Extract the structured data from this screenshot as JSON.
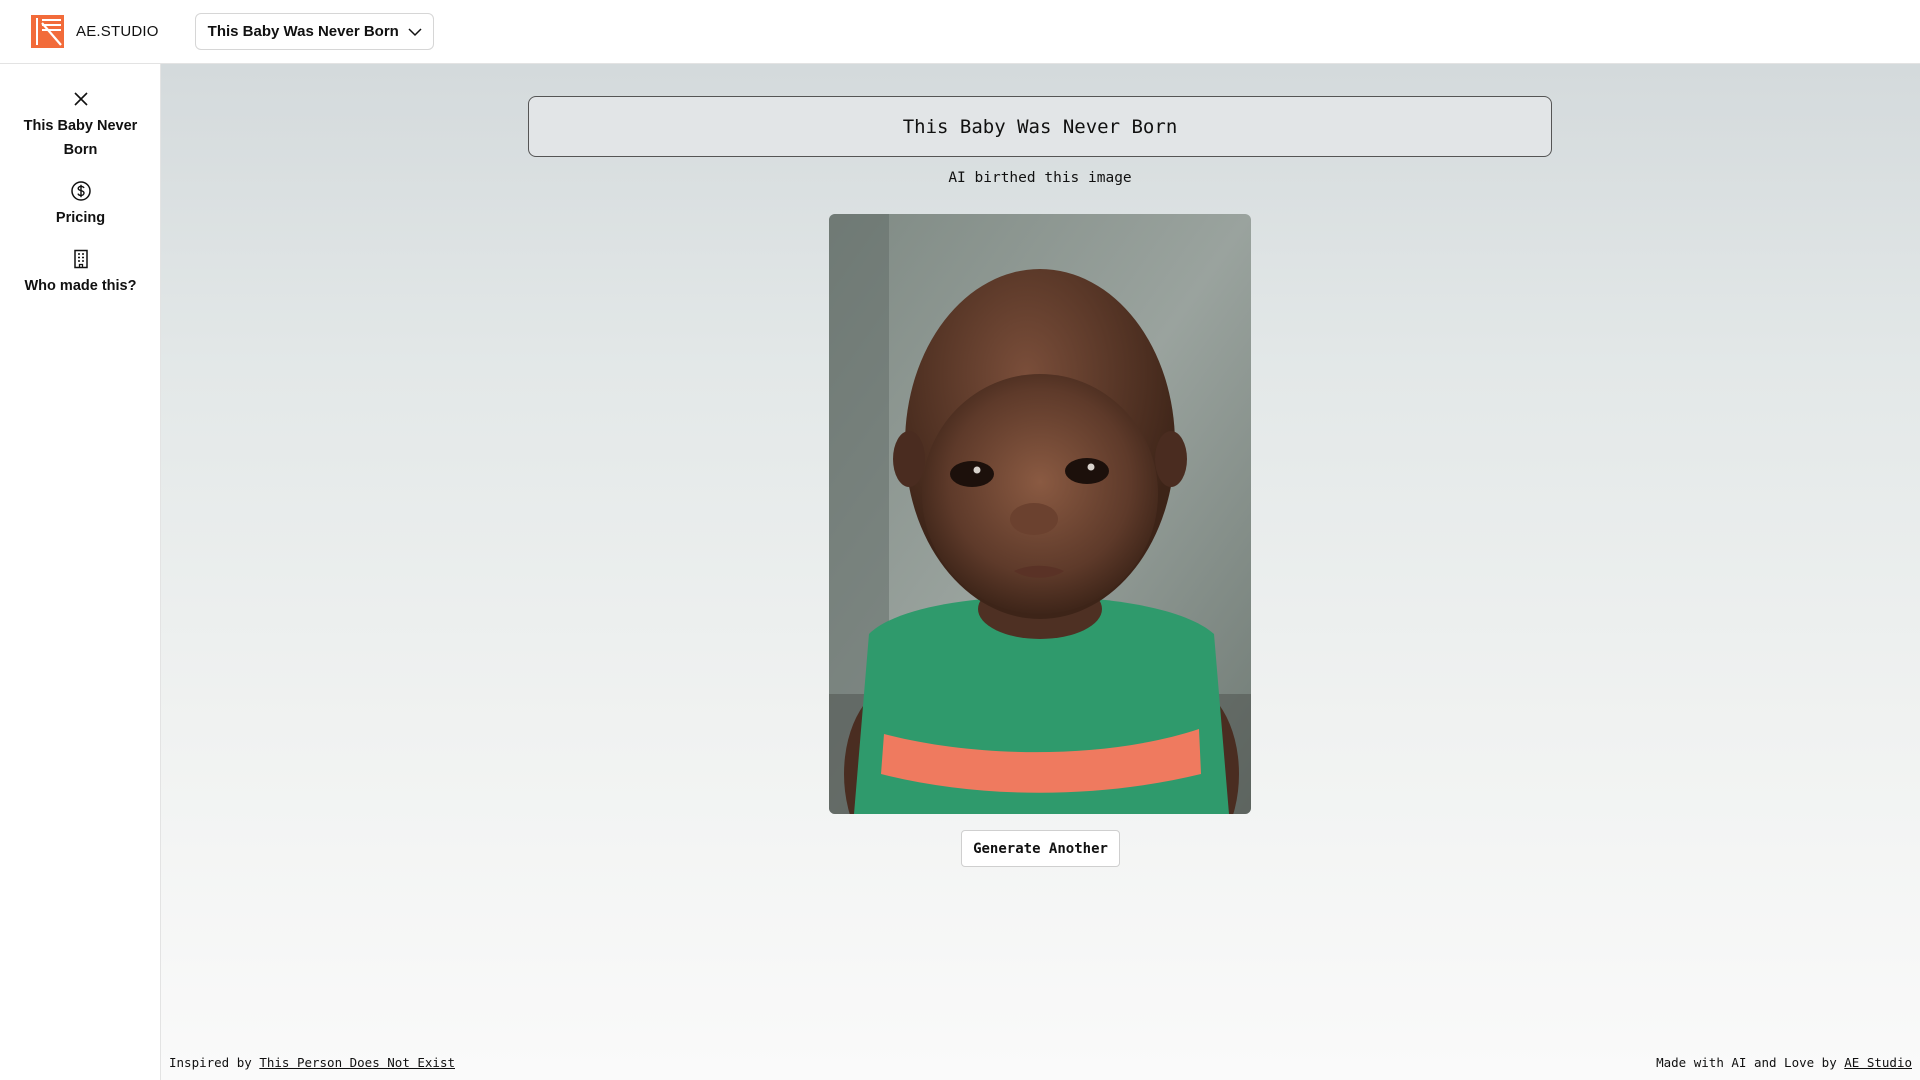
{
  "brand": {
    "name": "AE.STUDIO",
    "logo_icon": "ae-studio-logo-icon",
    "accent": "#f26b3a"
  },
  "header": {
    "product_selector": {
      "selected": "This Baby Was Never Born",
      "icon": "chevron-down-icon"
    }
  },
  "sidebar": {
    "items": [
      {
        "label": "This Baby Never Born",
        "icon": "close-icon"
      },
      {
        "label": "Pricing",
        "icon": "dollar-circle-icon"
      },
      {
        "label": "Who made this?",
        "icon": "building-icon"
      }
    ]
  },
  "main": {
    "title": "This Baby Was Never Born",
    "subtitle": "AI birthed this image",
    "image": {
      "alt": "AI generated baby",
      "shirt_color": "#2f9a6c",
      "stripe_color": "#ef7a5f"
    },
    "generate_button": "Generate Another"
  },
  "footer": {
    "left_prefix": "Inspired by",
    "left_link": "This Person Does Not Exist",
    "right_prefix": "Made with AI and Love by",
    "right_link": "AE Studio"
  }
}
